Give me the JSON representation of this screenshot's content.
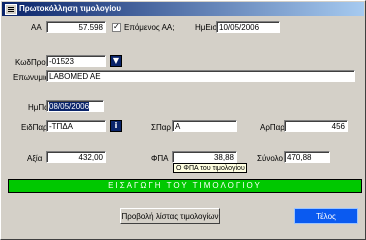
{
  "window": {
    "title": "Πρωτοκόλληση τιμολογίου"
  },
  "form": {
    "aa_label": "ΑΑ",
    "aa_value": "57.598",
    "epomenos_label": "Επόμενος ΑΑ;",
    "hmeis_label": "ΗμΕισ",
    "hmeis_value": "10/05/2006",
    "kodpro_label": "ΚωδΠρο",
    "kodpro_value": "-01523",
    "eponymia_label": "Επωνυμια",
    "eponymia_value": "LABOMED     AE",
    "hmpar_label": "ΗμΠαρ",
    "hmpar_value": "08/05/2006",
    "eidpar_label": "ΕιδΠαρ",
    "eidpar_value": "-ΤΠΔΑ",
    "spar_label": "ΣΠαρ",
    "spar_value": "Α",
    "arpar_label": "ΑρΠαρ",
    "arpar_value": "456",
    "axia_label": "Αξία",
    "axia_value": "432,00",
    "fpa_label": "ΦΠΑ",
    "fpa_value": "38,88",
    "synolo_label": "Σύνολο",
    "synolo_value": "470,88",
    "fpa_tooltip": "Ο ΦΠΑ του τιμολογίου"
  },
  "actions": {
    "import_label": "ΕΙΣΑΓΩΓΗ ΤΟΥ ΤΙΜΟΛΟΓΙΟΥ",
    "view_list_label": "Προβολή λίστας τιμολογίων",
    "end_label": "Τέλος"
  },
  "icons": {
    "lookup_icon": "filter-icon",
    "info_icon": "info-icon"
  },
  "colors": {
    "import_bar": "#00c800",
    "end_button": "#0a5af0",
    "titlebar": "#0a246a"
  }
}
